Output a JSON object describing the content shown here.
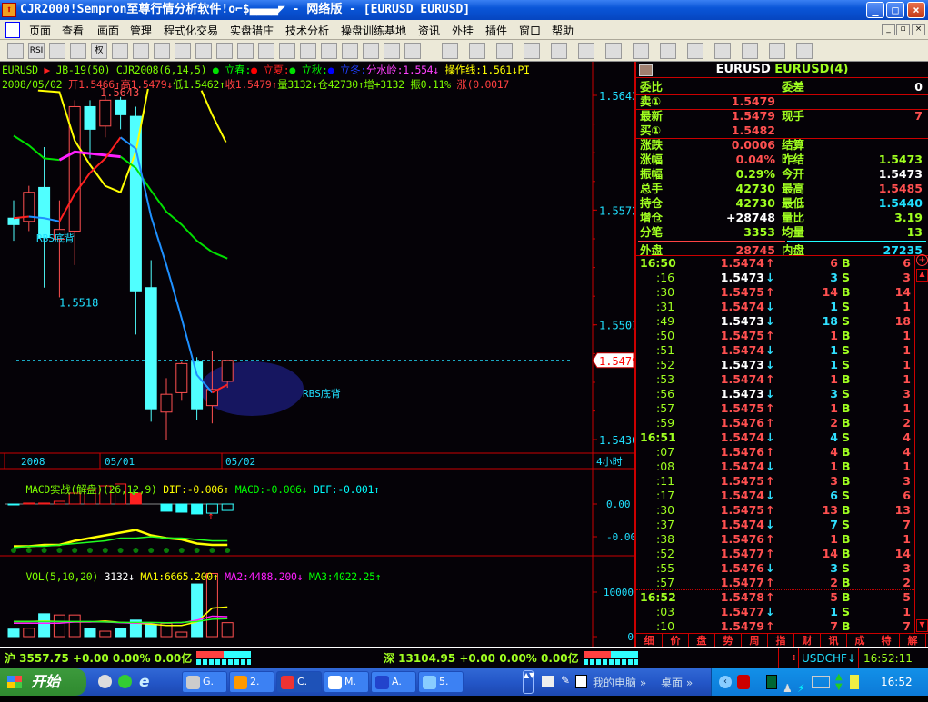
{
  "window": {
    "title": "CJR2000!Sempron至尊行情分析软件!o⌐$▄▄▄▄◤ - 网络版 - [EURUSD EURUSD]",
    "app_icon": "app-icon",
    "controls": [
      "_",
      "□",
      "×"
    ]
  },
  "menu": {
    "items": [
      "页面",
      "查看",
      "画面",
      "管理",
      "程式化交易",
      "实盘猎庄",
      "技术分析",
      "操盘训练基地",
      "资讯",
      "外挂",
      "插件",
      "窗口",
      "帮助"
    ],
    "mdi": [
      "_",
      "▫",
      "×"
    ]
  },
  "toolbar": {
    "rsi": "RSI",
    "quan": "权",
    "icons": [
      "open-folder-icon",
      "rsi-icon",
      "move-icon",
      "resize-icon",
      "rights-icon",
      "traffic-light-icon",
      "binoculars-icon",
      "calendar-icon",
      "copy-icon",
      "book-icon",
      "search-icon",
      "lion-icon",
      "alarm-bell-icon",
      "pen-icon",
      "layout-rows-icon",
      "layout-cols-icon",
      "window-icon",
      "window2-icon",
      "window3-icon",
      "chart-icon",
      "cursor-icon",
      "line-icon",
      "fib-icon",
      "vlines-icon",
      "fan-icon",
      "channel-icon",
      "parallel-icon",
      "rect-icon",
      "ellipse-icon",
      "text-icon",
      "eraser-icon",
      "highlighter-icon",
      "palette-icon",
      "save-icon"
    ]
  },
  "chart_header": {
    "line1": [
      {
        "t": "EURUSD ",
        "c": "#7cfc00"
      },
      {
        "t": "▶ ",
        "c": "#ff2020"
      },
      {
        "t": "JB-19(50) CJR2008(6,14,5) ",
        "c": "#7cfc00"
      },
      {
        "t": "● ",
        "c": "#00e000"
      },
      {
        "t": "立春:",
        "c": "#00ff00"
      },
      {
        "t": "● ",
        "c": "#ff0000"
      },
      {
        "t": "立夏:",
        "c": "#ff2020"
      },
      {
        "t": "● ",
        "c": "#00e000"
      },
      {
        "t": "立秋:",
        "c": "#00ff00"
      },
      {
        "t": "● ",
        "c": "#0000ff"
      },
      {
        "t": "立冬:",
        "c": "#2040ff"
      },
      {
        "t": "分水岭:1.554↓",
        "c": "#ff40ff"
      },
      {
        "t": " 操作线:1.561↓PI",
        "c": "#ffff00"
      }
    ],
    "line2": [
      {
        "t": "2008/05/02 ",
        "c": "#7cfc00"
      },
      {
        "t": "开1.5466↑",
        "c": "#ff4040"
      },
      {
        "t": "高1.5479↓",
        "c": "#ff4040"
      },
      {
        "t": "低1.5462↑",
        "c": "#7cfc00"
      },
      {
        "t": "收1.5479↑",
        "c": "#ff4040"
      },
      {
        "t": "量3132↓",
        "c": "#7cfc00"
      },
      {
        "t": "仓42730↑",
        "c": "#7cfc00"
      },
      {
        "t": "增+3132 ",
        "c": "#7cfc00"
      },
      {
        "t": "振0.11% ",
        "c": "#7cfc00"
      },
      {
        "t": "涨(0.0017",
        "c": "#ff4040"
      }
    ]
  },
  "chart_data": [
    {
      "type": "candlestick",
      "title": "EURUSD 4小时",
      "ylim": [
        1.543,
        1.5643
      ],
      "y_ticks": [
        "1.5643",
        "1.5572",
        "1.5501",
        "1.5430"
      ],
      "current_price": "1.5479",
      "high_label": "1.5643",
      "low_label": "1.5518",
      "x_labels": [
        "2008",
        "05/01",
        "05/02"
      ],
      "period_label": "4小时",
      "annotations": [
        "RBS底背",
        "RBS底背"
      ],
      "candles": [
        {
          "o": 1.5567,
          "h": 1.5578,
          "l": 1.5553,
          "c": 1.5563
        },
        {
          "o": 1.5565,
          "h": 1.5587,
          "l": 1.5559,
          "c": 1.5583
        },
        {
          "o": 1.5586,
          "h": 1.5611,
          "l": 1.5524,
          "c": 1.5555
        },
        {
          "o": 1.5554,
          "h": 1.5578,
          "l": 1.5518,
          "c": 1.556
        },
        {
          "o": 1.5559,
          "h": 1.564,
          "l": 1.5538,
          "c": 1.5636
        },
        {
          "o": 1.5636,
          "h": 1.564,
          "l": 1.5604,
          "c": 1.5622
        },
        {
          "o": 1.5624,
          "h": 1.5643,
          "l": 1.5617,
          "c": 1.564
        },
        {
          "o": 1.564,
          "h": 1.5642,
          "l": 1.5622,
          "c": 1.5631
        },
        {
          "o": 1.563,
          "h": 1.5636,
          "l": 1.5495,
          "c": 1.5522
        },
        {
          "o": 1.5524,
          "h": 1.5541,
          "l": 1.5441,
          "c": 1.5449
        },
        {
          "o": 1.5447,
          "h": 1.5468,
          "l": 1.543,
          "c": 1.5458
        },
        {
          "o": 1.5459,
          "h": 1.5478,
          "l": 1.5454,
          "c": 1.5477
        },
        {
          "o": 1.5478,
          "h": 1.5481,
          "l": 1.5442,
          "c": 1.5449
        },
        {
          "o": 1.5451,
          "h": 1.5485,
          "l": 1.544,
          "c": 1.5461
        },
        {
          "o": 1.5466,
          "h": 1.5479,
          "l": 1.5462,
          "c": 1.5479
        }
      ],
      "lines": [
        {
          "name": "yellow-1",
          "color": "#ffff00",
          "pts": [
            [
              1.6,
              1.5646
            ],
            [
              3,
              1.5645
            ],
            [
              4,
              1.5615
            ],
            [
              5,
              1.56
            ],
            [
              6,
              1.5587
            ],
            [
              7,
              1.5583
            ],
            [
              8,
              1.5608
            ],
            [
              8.8,
              1.5647
            ]
          ]
        },
        {
          "name": "yellow-2",
          "color": "#ffff00",
          "pts": [
            [
              12.3,
              1.5646
            ],
            [
              13,
              1.5631
            ],
            [
              13.9,
              1.5614
            ]
          ]
        },
        {
          "name": "green",
          "color": "#00e000",
          "pts": [
            [
              0,
              1.5618
            ],
            [
              1,
              1.5612
            ],
            [
              2,
              1.5604
            ],
            [
              3,
              1.5603
            ]
          ]
        },
        {
          "name": "magenta",
          "color": "#ff20ff",
          "pts": [
            [
              3,
              1.5603
            ],
            [
              4,
              1.5608
            ],
            [
              5,
              1.5607
            ],
            [
              6,
              1.5606
            ],
            [
              7,
              1.5605
            ]
          ]
        },
        {
          "name": "green-2",
          "color": "#00e000",
          "pts": [
            [
              7,
              1.5605
            ],
            [
              8,
              1.5598
            ],
            [
              9,
              1.5584
            ],
            [
              10,
              1.5571
            ],
            [
              11,
              1.5563
            ],
            [
              12,
              1.5553
            ],
            [
              13,
              1.5546
            ],
            [
              14,
              1.5542
            ]
          ]
        },
        {
          "name": "red-1",
          "color": "#ff2020",
          "pts": [
            [
              0,
              1.5567
            ],
            [
              1,
              1.5568
            ]
          ]
        },
        {
          "name": "blue-1",
          "color": "#1e90ff",
          "pts": [
            [
              1,
              1.5568
            ],
            [
              2,
              1.5567
            ],
            [
              3,
              1.5565
            ]
          ]
        },
        {
          "name": "red-2",
          "color": "#ff2020",
          "pts": [
            [
              3,
              1.5565
            ],
            [
              4,
              1.5582
            ],
            [
              5,
              1.5595
            ],
            [
              6,
              1.5604
            ],
            [
              7,
              1.5617
            ]
          ]
        },
        {
          "name": "blue-2",
          "color": "#1e90ff",
          "pts": [
            [
              7,
              1.5617
            ],
            [
              8,
              1.561
            ],
            [
              9,
              1.5568
            ],
            [
              10,
              1.5538
            ],
            [
              11,
              1.5505
            ],
            [
              12,
              1.547
            ],
            [
              13,
              1.5459
            ]
          ]
        },
        {
          "name": "red-3",
          "color": "#ff2020",
          "pts": [
            [
              13,
              1.5459
            ],
            [
              14,
              1.5464
            ]
          ]
        }
      ]
    },
    {
      "type": "bar",
      "title": "MACD实战(解盘)(26,12,9)",
      "units": "0.0001",
      "y_ticks": [
        "0.00",
        "-0.00"
      ],
      "hist": [
        -0.5,
        0.7,
        0.7,
        2,
        8,
        10.7,
        13.3,
        14.7,
        8,
        0,
        -5.3,
        -6,
        -7.3,
        -6.7,
        -4.7
      ],
      "hist_filled": [
        true,
        false,
        false,
        false,
        false,
        false,
        false,
        false,
        true,
        false,
        true,
        true,
        true,
        false,
        false
      ],
      "dif": [
        -31,
        -31,
        -30,
        -30,
        -27,
        -25,
        -23,
        -21,
        -19,
        -23,
        -25,
        -26,
        -29,
        -30,
        -30
      ],
      "dea": [
        -32,
        -31,
        -31,
        -30,
        -29,
        -28,
        -27,
        -25,
        -25,
        -24,
        -25,
        -25,
        -26,
        -27,
        -27
      ],
      "legend": [
        {
          "t": "MACD实战(解盘)(26,12,9) ",
          "c": "#7cfc00"
        },
        {
          "t": "DIF:-0.006↑ ",
          "c": "#ffff00"
        },
        {
          "t": "MACD:-0.006↓ ",
          "c": "#00ff00"
        },
        {
          "t": "DEF:-0.001↑",
          "c": "#00ffff"
        }
      ]
    },
    {
      "type": "bar",
      "title": "VOL(5,10,20)",
      "y_ticks": [
        "10000",
        "0"
      ],
      "ylim": [
        0,
        15000
      ],
      "values": [
        1690,
        1890,
        5135,
        4865,
        4865,
        1890,
        1216,
        1890,
        3716,
        2700,
        2973,
        1014,
        11824,
        14189,
        3132
      ],
      "up": [
        false,
        true,
        false,
        true,
        true,
        false,
        true,
        false,
        false,
        false,
        true,
        true,
        false,
        true,
        true
      ],
      "ma1": [
        3400,
        3400,
        3500,
        3400,
        3300,
        3300,
        3500,
        3200,
        3000,
        2800,
        2500,
        2500,
        3300,
        6400,
        6665
      ],
      "ma2": [
        3000,
        3000,
        3000,
        3000,
        3300,
        3300,
        3300,
        3100,
        3000,
        3100,
        3100,
        3100,
        3700,
        4600,
        4488
      ],
      "ma3": [
        3400,
        3400,
        3400,
        3400,
        3400,
        3400,
        3300,
        3200,
        3200,
        3200,
        3100,
        3200,
        3400,
        3900,
        4022
      ],
      "legend": [
        {
          "t": "VOL(5,10,20) ",
          "c": "#7cfc00"
        },
        {
          "t": "3132↓ ",
          "c": "#ffffff"
        },
        {
          "t": "MA1:6665.200↑ ",
          "c": "#ffff00"
        },
        {
          "t": "MA2:4488.200↓ ",
          "c": "#ff20ff"
        },
        {
          "t": "MA3:4022.25↑",
          "c": "#00ff00"
        }
      ]
    }
  ],
  "quote": {
    "symbol": "EURUSD",
    "name": "EURUSD(4)",
    "rows": [
      {
        "l1": "委比",
        "v1": "",
        "c1": "#ff5050",
        "l2": "委差",
        "v2": "0",
        "c2": "#ffffff"
      },
      {
        "l1": "卖①",
        "v1": "1.5479",
        "c1": "#ff5050",
        "l2": "",
        "v2": "",
        "c2": "#fff"
      },
      {
        "l1": "最新",
        "v1": "1.5479",
        "c1": "#ff5050",
        "l2": "现手",
        "v2": "7",
        "c2": "#ff5050"
      },
      {
        "l1": "买①",
        "v1": "1.5482",
        "c1": "#ff5050",
        "l2": "",
        "v2": "",
        "c2": "#fff"
      },
      {
        "l1": "涨跌",
        "v1": "0.0006",
        "c1": "#ff5050",
        "l2": "结算",
        "v2": "",
        "c2": "#fff"
      },
      {
        "l1": "涨幅",
        "v1": "0.04%",
        "c1": "#ff5050",
        "l2": "昨结",
        "v2": "1.5473",
        "c2": "#a0ff20"
      },
      {
        "l1": "振幅",
        "v1": "0.29%",
        "c1": "#a0ff20",
        "l2": "今开",
        "v2": "1.5473",
        "c2": "#ffffff"
      },
      {
        "l1": "总手",
        "v1": "42730",
        "c1": "#a0ff20",
        "l2": "最高",
        "v2": "1.5485",
        "c2": "#ff5050"
      },
      {
        "l1": "持仓",
        "v1": "42730",
        "c1": "#a0ff20",
        "l2": "最低",
        "v2": "1.5440",
        "c2": "#20e0ff"
      },
      {
        "l1": "增仓",
        "v1": "+28748",
        "c1": "#ffffff",
        "l2": "量比",
        "v2": "3.19",
        "c2": "#a0ff20"
      },
      {
        "l1": "分笔",
        "v1": "3353",
        "c1": "#a0ff20",
        "l2": "均量",
        "v2": "13",
        "c2": "#a0ff20"
      },
      {
        "l1": "外盘",
        "v1": "28745",
        "c1": "#ff5050",
        "l2": "内盘",
        "v2": "27235",
        "c2": "#20e0ff"
      }
    ]
  },
  "trades": [
    {
      "t": "16:50",
      "p": "1.5474",
      "d": "↑",
      "v": "6",
      "bs": "B",
      "n": "6"
    },
    {
      "t": ":16",
      "p": "1.5473",
      "d": "↓",
      "v": "3",
      "bs": "S",
      "n": "3"
    },
    {
      "t": ":30",
      "p": "1.5475",
      "d": "↑",
      "v": "14",
      "bs": "B",
      "n": "14"
    },
    {
      "t": ":31",
      "p": "1.5474",
      "d": "↓",
      "v": "1",
      "bs": "S",
      "n": "1"
    },
    {
      "t": ":49",
      "p": "1.5473",
      "d": "↓",
      "v": "18",
      "bs": "S",
      "n": "18"
    },
    {
      "t": ":50",
      "p": "1.5475",
      "d": "↑",
      "v": "1",
      "bs": "B",
      "n": "1"
    },
    {
      "t": ":51",
      "p": "1.5474",
      "d": "↓",
      "v": "1",
      "bs": "S",
      "n": "1"
    },
    {
      "t": ":52",
      "p": "1.5473",
      "d": "↓",
      "v": "1",
      "bs": "S",
      "n": "1"
    },
    {
      "t": ":53",
      "p": "1.5474",
      "d": "↑",
      "v": "1",
      "bs": "B",
      "n": "1"
    },
    {
      "t": ":56",
      "p": "1.5473",
      "d": "↓",
      "v": "3",
      "bs": "S",
      "n": "3"
    },
    {
      "t": ":57",
      "p": "1.5475",
      "d": "↑",
      "v": "1",
      "bs": "B",
      "n": "1"
    },
    {
      "t": ":59",
      "p": "1.5476",
      "d": "↑",
      "v": "2",
      "bs": "B",
      "n": "2"
    },
    {
      "t": "16:51",
      "p": "1.5474",
      "d": "↓",
      "v": "4",
      "bs": "S",
      "n": "4"
    },
    {
      "t": ":07",
      "p": "1.5476",
      "d": "↑",
      "v": "4",
      "bs": "B",
      "n": "4"
    },
    {
      "t": ":08",
      "p": "1.5474",
      "d": "↓",
      "v": "1",
      "bs": "B",
      "n": "1"
    },
    {
      "t": ":11",
      "p": "1.5475",
      "d": "↑",
      "v": "3",
      "bs": "B",
      "n": "3"
    },
    {
      "t": ":17",
      "p": "1.5474",
      "d": "↓",
      "v": "6",
      "bs": "S",
      "n": "6"
    },
    {
      "t": ":30",
      "p": "1.5475",
      "d": "↑",
      "v": "13",
      "bs": "B",
      "n": "13"
    },
    {
      "t": ":37",
      "p": "1.5474",
      "d": "↓",
      "v": "7",
      "bs": "S",
      "n": "7"
    },
    {
      "t": ":38",
      "p": "1.5476",
      "d": "↑",
      "v": "1",
      "bs": "B",
      "n": "1"
    },
    {
      "t": ":52",
      "p": "1.5477",
      "d": "↑",
      "v": "14",
      "bs": "B",
      "n": "14"
    },
    {
      "t": ":55",
      "p": "1.5476",
      "d": "↓",
      "v": "3",
      "bs": "S",
      "n": "3"
    },
    {
      "t": ":57",
      "p": "1.5477",
      "d": "↑",
      "v": "2",
      "bs": "B",
      "n": "2"
    },
    {
      "t": "16:52",
      "p": "1.5478",
      "d": "↑",
      "v": "5",
      "bs": "B",
      "n": "5"
    },
    {
      "t": ":03",
      "p": "1.5477",
      "d": "↓",
      "v": "1",
      "bs": "S",
      "n": "1"
    },
    {
      "t": ":10",
      "p": "1.5479",
      "d": "↑",
      "v": "7",
      "bs": "B",
      "n": "7"
    }
  ],
  "panel_tabs": [
    "细",
    "价",
    "盘",
    "势",
    "周",
    "指",
    "财",
    "讯",
    "成",
    "特",
    "解"
  ],
  "status": {
    "sh": "沪 3557.75 +0.00 0.00% 0.00亿",
    "sz": "深 13104.95 +0.00 0.00% 0.00亿",
    "ticker": "USDCHF↓",
    "time": "16:52:11"
  },
  "taskbar": {
    "start": "开始",
    "tasks": [
      "G.",
      "2.",
      "C.",
      "M.",
      "A.",
      "5."
    ],
    "active_task": 2,
    "toolbars": [
      "我的电脑 »",
      "桌面 »"
    ],
    "clock": "16:52"
  },
  "colors": {
    "up": "#ff5050",
    "down": "#50ffff",
    "axis": "#c00000",
    "bg": "#050207"
  }
}
